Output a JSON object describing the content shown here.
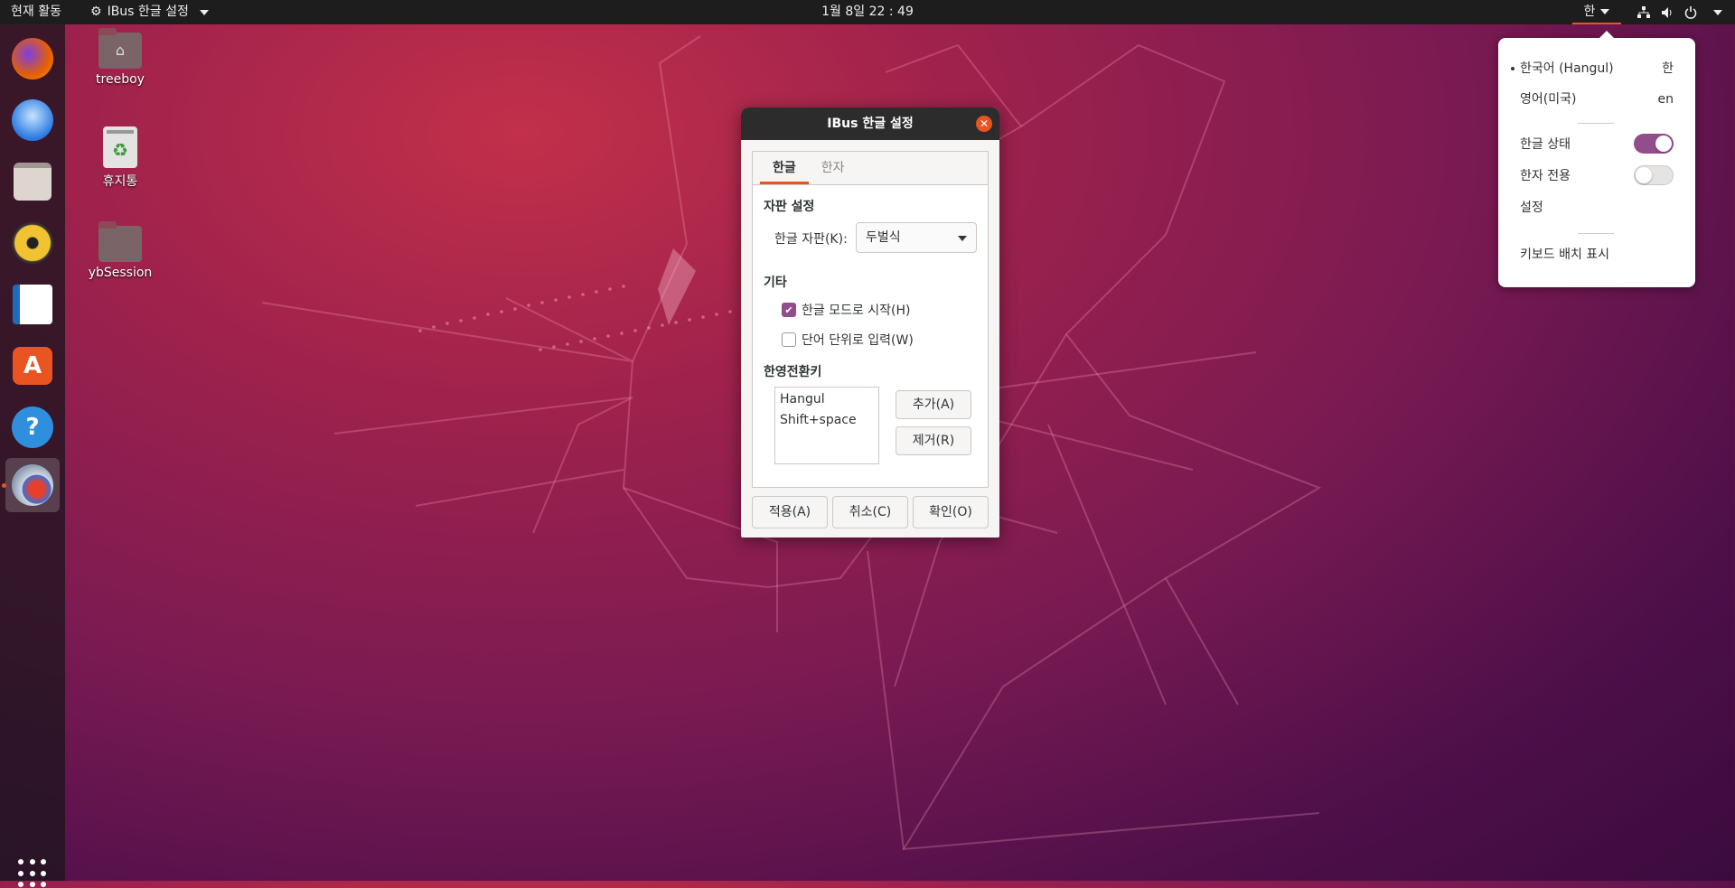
{
  "topbar": {
    "activities": "현재 활동",
    "app_name": "IBus 한글 설정",
    "clock": "1월 8일  22 : 49",
    "input_indicator": "한"
  },
  "dock": {
    "items": [
      "firefox-icon",
      "thunderbird-icon",
      "files-icon",
      "rhythmbox-icon",
      "libreoffice-writer-icon",
      "software-center-icon",
      "help-icon",
      "ibus-setup-icon"
    ]
  },
  "desktop": {
    "icons": [
      {
        "label": "treeboy",
        "glyph": "⌂"
      },
      {
        "label": "휴지통",
        "glyph": "♻"
      },
      {
        "label": "ybSession",
        "glyph": ""
      }
    ]
  },
  "dialog": {
    "title": "IBus 한글 설정",
    "close_glyph": "✕",
    "tabs": [
      "한글",
      "한자"
    ],
    "section_layout": "자판 설정",
    "layout_label": "한글 자판(K):",
    "layout_value": "두벌식",
    "section_etc": "기타",
    "check_hangul_mode": {
      "label": "한글 모드로 시작(H)",
      "checked": true
    },
    "check_word_commit": {
      "label": "단어 단위로 입력(W)",
      "checked": false
    },
    "section_toggle": "한영전환키",
    "toggle_keys": [
      "Hangul",
      "Shift+space"
    ],
    "add_button": "추가(A)",
    "remove_button": "제거(R)",
    "apply_button": "적용(A)",
    "cancel_button": "취소(C)",
    "ok_button": "확인(O)"
  },
  "im_popup": {
    "sources": [
      {
        "label": "한국어 (Hangul)",
        "short": "한",
        "active": true
      },
      {
        "label": "영어(미국)",
        "short": "en",
        "active": false
      }
    ],
    "hangul_state": {
      "label": "한글 상태",
      "on": true
    },
    "hanja_only": {
      "label": "한자 전용",
      "on": false
    },
    "settings": "설정",
    "show_layout": "키보드 배치 표시"
  },
  "colors": {
    "accent": "#e95420",
    "toggle_on": "#924d8b",
    "topbar": "#1d1d1d"
  }
}
